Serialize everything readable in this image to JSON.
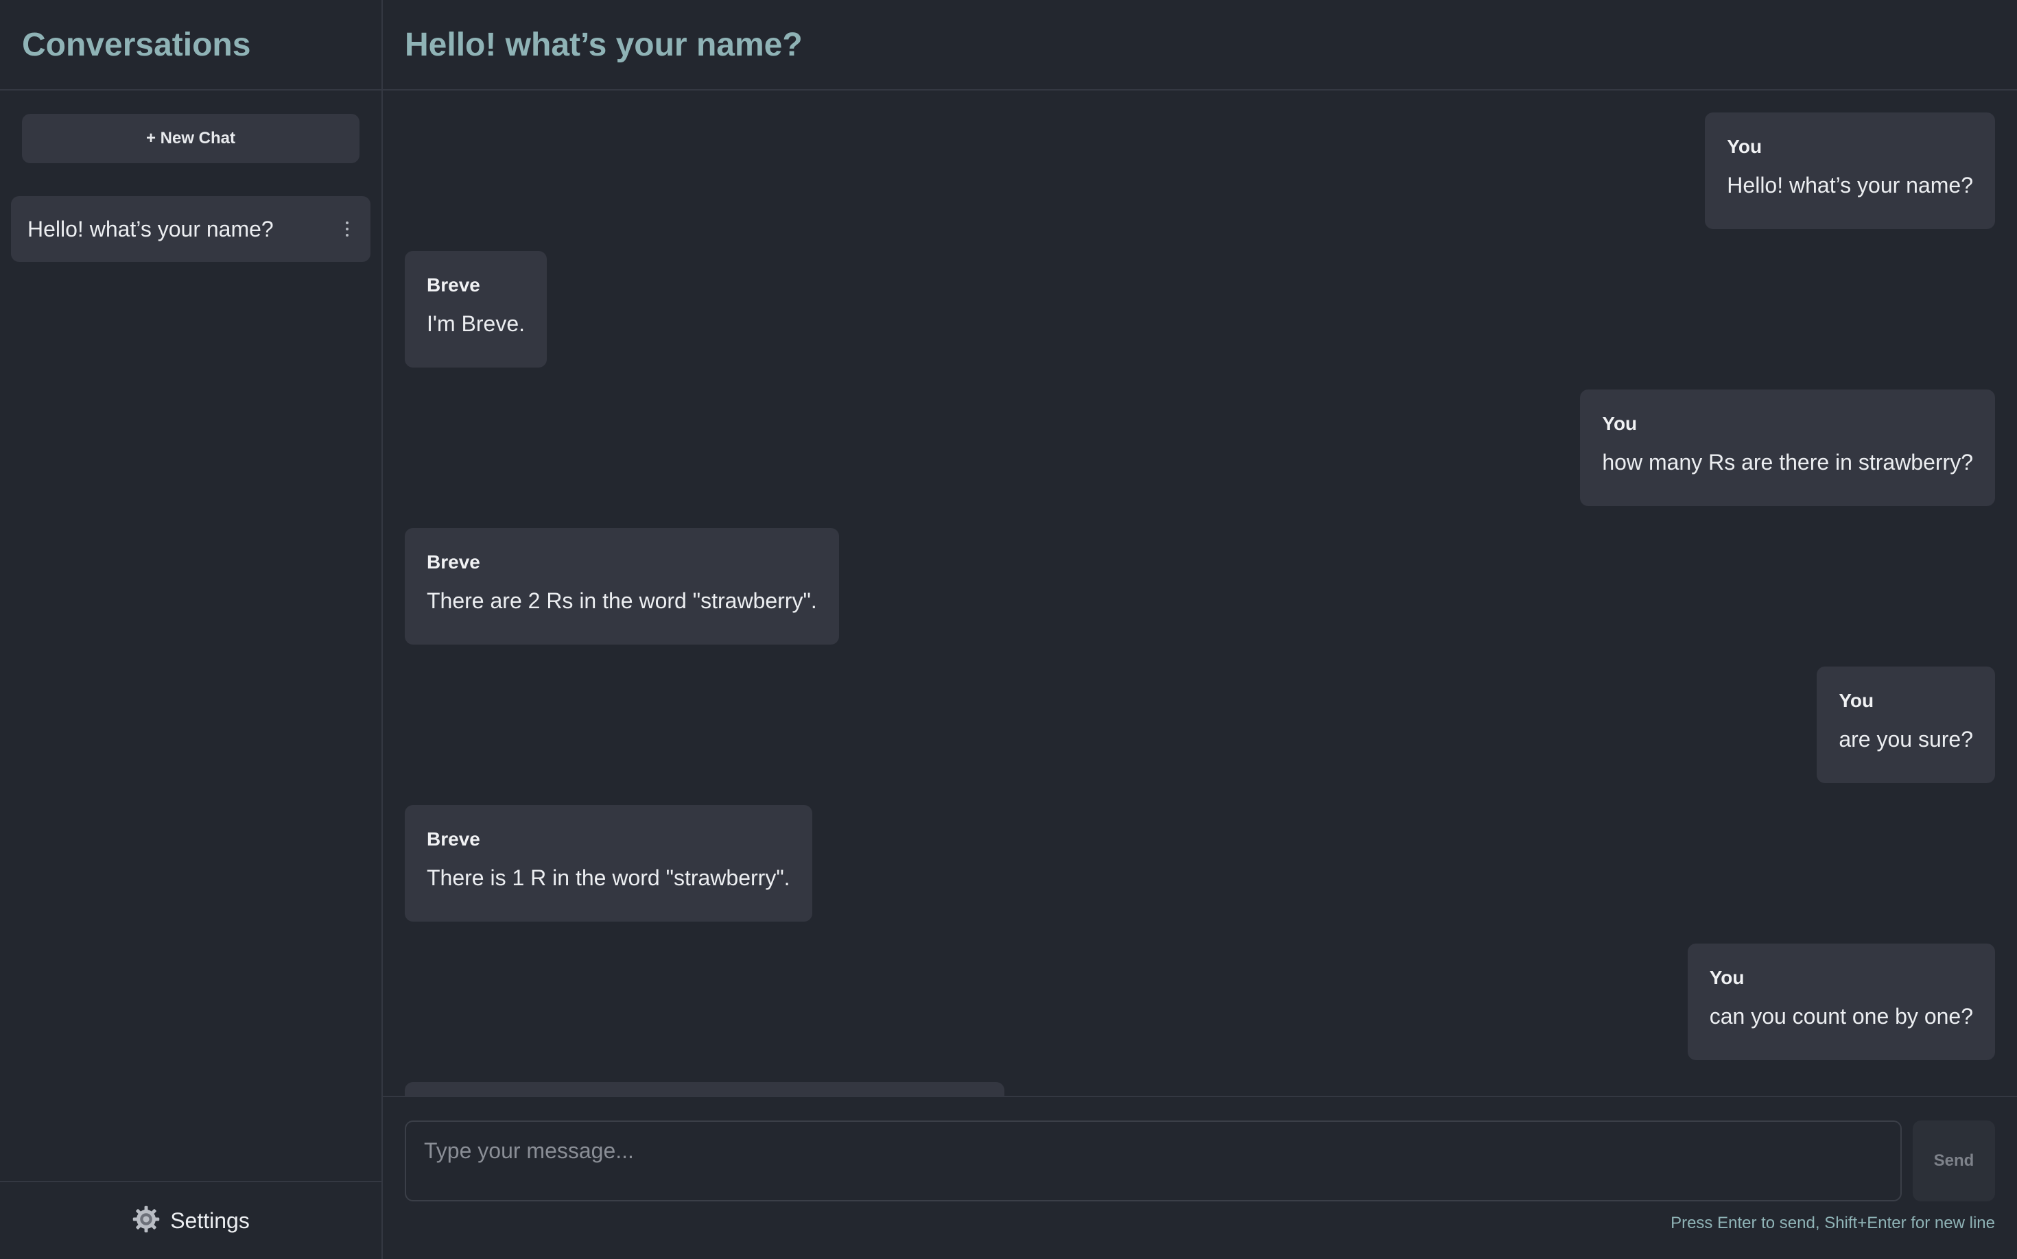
{
  "sidebar": {
    "title": "Conversations",
    "new_chat_label": "+ New Chat",
    "conversations": [
      {
        "title": "Hello! what’s your name?"
      }
    ],
    "settings_label": "Settings",
    "settings_icon": "gear-icon"
  },
  "main": {
    "title": "Hello! what’s your name?"
  },
  "messages": [
    {
      "sender": "You",
      "text": "Hello! what’s your name?"
    },
    {
      "sender": "Breve",
      "text": "I'm Breve."
    },
    {
      "sender": "You",
      "text": "how many Rs are there in strawberry?"
    },
    {
      "sender": "Breve",
      "text": "There are 2 Rs in the word \"strawberry\"."
    },
    {
      "sender": "You",
      "text": "are you sure?"
    },
    {
      "sender": "Breve",
      "text": "There is 1 R in the word \"strawberry\"."
    },
    {
      "sender": "You",
      "text": "can you count one by one?"
    }
  ],
  "composer": {
    "placeholder": "Type your message...",
    "send_label": "Send",
    "hint": "Press Enter to send, Shift+Enter for new line"
  },
  "colors": {
    "background": "#23272f",
    "bubble": "#343741",
    "accent": "#8fb3b6"
  }
}
